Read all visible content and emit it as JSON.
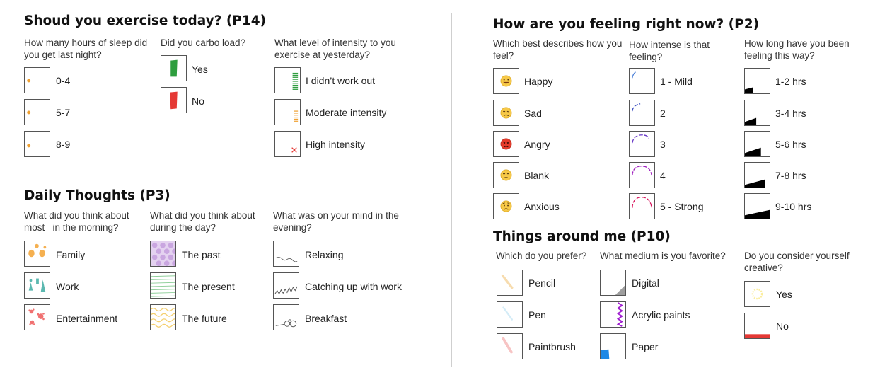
{
  "p14": {
    "title": "Shoud you exercise today? (P14)",
    "q1": "How many hours of sleep did you get last night?",
    "q1_opts": [
      "0-4",
      "5-7",
      "8-9"
    ],
    "q2": "Did you carbo load?",
    "q2_opts": [
      "Yes",
      "No"
    ],
    "q3": "What level of intensity to you exercise at yesterday?",
    "q3_opts": [
      "I didn’t work out",
      "Moderate intensity",
      "High intensity"
    ]
  },
  "p3": {
    "title": "Daily Thoughts (P3)",
    "q1": "What did you think about most   in the morning?",
    "q1_opts": [
      "Family",
      "Work",
      "Entertainment"
    ],
    "q2": "What did you think about during the day?",
    "q2_opts": [
      "The past",
      "The present",
      "The future"
    ],
    "q3": "What was on your mind in the evening?",
    "q3_opts": [
      "Relaxing",
      "Catching up with work",
      "Breakfast"
    ]
  },
  "p2": {
    "title": "How are you feeling right now? (P2)",
    "q1": "Which best describes how you feel?",
    "q1_opts": [
      "Happy",
      "Sad",
      "Angry",
      "Blank",
      "Anxious"
    ],
    "q2": "How intense is that feeling?",
    "q2_opts": [
      "1 - Mild",
      "2",
      "3",
      "4",
      "5 - Strong"
    ],
    "q3": "How long have you been feeling this way?",
    "q3_opts": [
      "1-2 hrs",
      "3-4 hrs",
      "5-6 hrs",
      "7-8 hrs",
      "9-10 hrs"
    ]
  },
  "p10": {
    "title": "Things around me (P10)",
    "q1": "Which do you prefer?",
    "q1_opts": [
      "Pencil",
      "Pen",
      "Paintbrush"
    ],
    "q2": "What medium is you favorite?",
    "q2_opts": [
      "Digital",
      "Acrylic paints",
      "Paper"
    ],
    "q3": "Do you consider yourself creative?",
    "q3_opts": [
      "Yes",
      "No"
    ]
  },
  "colors": {
    "orange": "#f0a030",
    "green": "#2e9e3e",
    "red": "#e53935",
    "intensity_stroke": "#c02060",
    "teal": "#5bb8b0",
    "lavender": "#c9a6e0",
    "paper_blue": "#1e88e5",
    "acrylic_purple": "#a020d0"
  },
  "icons": {
    "sleep": "small-orange-dot-icon",
    "carbo_yes": "green-bar-icon",
    "carbo_no": "red-bar-icon",
    "mood_emoji": [
      "grinning-face-icon",
      "disappointed-face-icon",
      "angry-face-icon",
      "unamused-face-icon",
      "worried-face-icon"
    ]
  }
}
